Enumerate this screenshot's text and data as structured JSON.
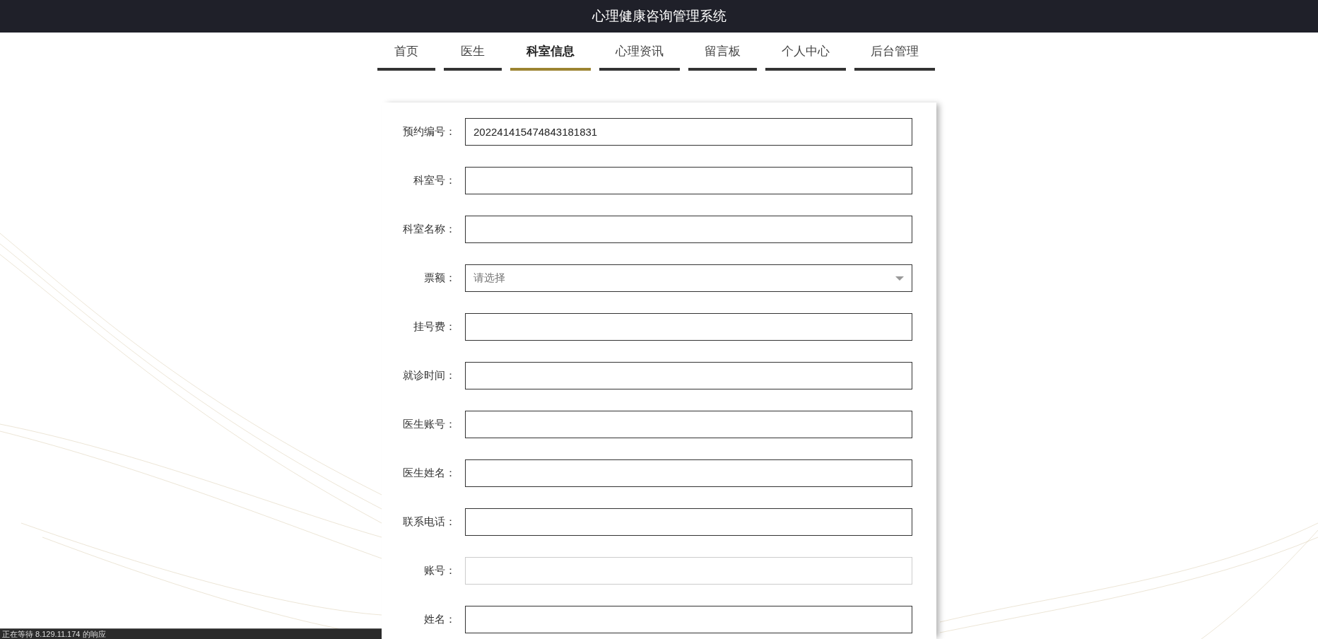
{
  "header": {
    "title": "心理健康咨询管理系统"
  },
  "nav": [
    {
      "label": "首页",
      "selected": false
    },
    {
      "label": "医生",
      "selected": false
    },
    {
      "label": "科室信息",
      "selected": true
    },
    {
      "label": "心理资讯",
      "selected": false
    },
    {
      "label": "留言板",
      "selected": false
    },
    {
      "label": "个人中心",
      "selected": false
    },
    {
      "label": "后台管理",
      "selected": false
    }
  ],
  "form": {
    "fields": [
      {
        "label": "预约编号：",
        "kind": "text",
        "value": "202241415474843181831",
        "disabled": false
      },
      {
        "label": "科室号：",
        "kind": "text",
        "disabled": false
      },
      {
        "label": "科室名称：",
        "kind": "text",
        "disabled": false
      },
      {
        "label": "票额：",
        "kind": "select",
        "placeholder": "请选择",
        "disabled": false
      },
      {
        "label": "挂号费：",
        "kind": "text",
        "disabled": false
      },
      {
        "label": "就诊时间：",
        "kind": "text",
        "disabled": false
      },
      {
        "label": "医生账号：",
        "kind": "text",
        "disabled": false
      },
      {
        "label": "医生姓名：",
        "kind": "text",
        "disabled": false
      },
      {
        "label": "联系电话：",
        "kind": "text",
        "disabled": false
      },
      {
        "label": "账号：",
        "kind": "text",
        "disabled": true
      },
      {
        "label": "姓名：",
        "kind": "text",
        "disabled": false
      }
    ]
  },
  "status_bar": {
    "text": "正在等待 8.129.11.174 的响应"
  }
}
